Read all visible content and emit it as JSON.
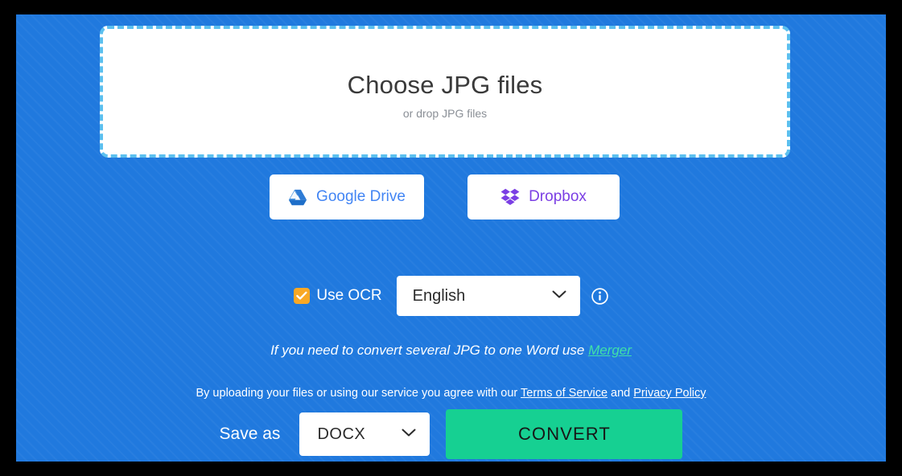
{
  "theme": {
    "page_background": "#2079DE",
    "dropzone_border": "#5CC0EF",
    "checkbox_accent": "#F9A825",
    "convert_button": "#16D092",
    "merger_link": "#3FE0A8",
    "gdrive_text": "#4285F4",
    "dropbox_text": "#7B3FE4",
    "frame": "#000000"
  },
  "dropzone": {
    "title": "Choose JPG files",
    "subtitle": "or drop JPG files",
    "icon": "dashed-upload-area"
  },
  "cloud_buttons": [
    {
      "label": "Google Drive",
      "icon": "google-drive-icon"
    },
    {
      "label": "Dropbox",
      "icon": "dropbox-icon"
    }
  ],
  "ocr": {
    "label": "Use OCR",
    "checked": true,
    "checkbox_icon": "checkmark-icon",
    "language": {
      "value": "English",
      "chevron_icon": "chevron-down-icon",
      "options": [
        "English"
      ]
    },
    "info_icon": "info-circle-icon"
  },
  "merger_hint": {
    "text_before": "If you need to convert several JPG to one Word use ",
    "link_label": "Merger"
  },
  "terms": {
    "text_before": "By uploading your files or using our service you agree with our ",
    "terms_label": "Terms of Service",
    "text_middle": " and ",
    "privacy_label": "Privacy Policy"
  },
  "save_as": {
    "label": "Save as",
    "format": {
      "value": "DOCX",
      "chevron_icon": "chevron-down-icon",
      "options": [
        "DOCX"
      ]
    },
    "convert_label": "CONVERT"
  }
}
